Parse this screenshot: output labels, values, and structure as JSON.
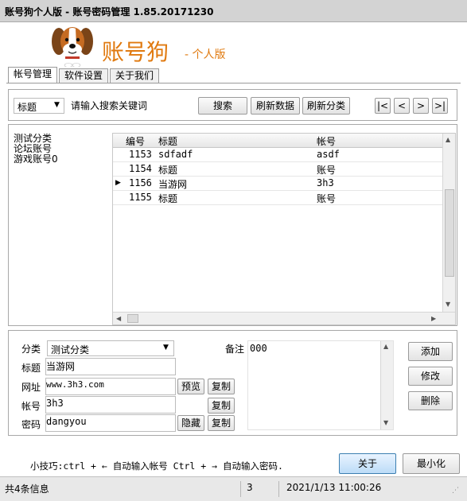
{
  "window": {
    "title": "账号狗个人版 - 账号密码管理 1.85.20171230"
  },
  "banner": {
    "name": "账号狗",
    "edition": "- 个人版"
  },
  "tabs": [
    {
      "label": "帐号管理",
      "active": true
    },
    {
      "label": "软件设置",
      "active": false
    },
    {
      "label": "关于我们",
      "active": false
    }
  ],
  "search": {
    "field_select": "标题",
    "placeholder": "请输入搜索关键词",
    "search_btn": "搜索",
    "refresh_data_btn": "刷新数据",
    "refresh_category_btn": "刷新分类",
    "nav": {
      "first": "|<",
      "prev": "<",
      "next": ">",
      "last": ">|"
    }
  },
  "categories": [
    "测试分类",
    "论坛账号",
    "游戏账号0"
  ],
  "grid": {
    "headers": {
      "id": "编号",
      "title": "标题",
      "account": "帐号"
    },
    "rows": [
      {
        "id": "1153",
        "title": "sdfadf",
        "account": "asdf",
        "current": false
      },
      {
        "id": "1154",
        "title": "标题",
        "account": "账号",
        "current": false
      },
      {
        "id": "1156",
        "title": "当游网",
        "account": "3h3",
        "current": true
      },
      {
        "id": "1155",
        "title": "标题",
        "account": "账号",
        "current": false
      }
    ],
    "current_marker": "▶"
  },
  "detail": {
    "category_label": "分类",
    "category_value": "测试分类",
    "note_label": "备注",
    "note_value": "000",
    "title_label": "标题",
    "title_value": "当游网",
    "url_label": "网址",
    "url_value": "www.3h3.com",
    "account_label": "帐号",
    "account_value": "3h3",
    "password_label": "密码",
    "password_value": "dangyou",
    "preview_btn": "预览",
    "copy_btn": "复制",
    "hide_btn": "隐藏",
    "add_btn": "添加",
    "edit_btn": "修改",
    "delete_btn": "删除"
  },
  "footer": {
    "tip": "小技巧:ctrl + ← 自动输入帐号 Ctrl + → 自动输入密码.",
    "about_btn": "关于",
    "minimize_btn": "最小化"
  },
  "status": {
    "count_text": "共4条信息",
    "value": "3",
    "datetime": "2021/1/13 11:00:26"
  },
  "colors": {
    "brand": "#e07a10",
    "accent": "#3c7fb1"
  }
}
